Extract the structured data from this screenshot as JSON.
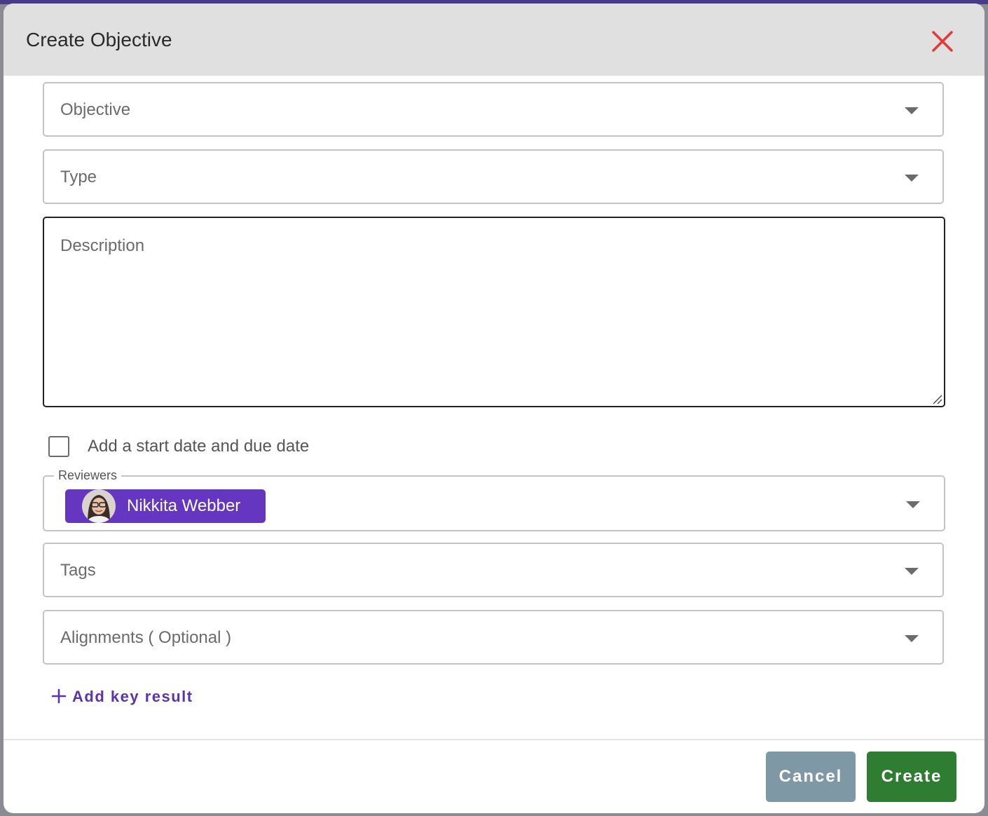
{
  "dialog": {
    "title": "Create Objective",
    "close_icon": "close-icon",
    "accent_color": "#6537c0",
    "close_color": "#e53935"
  },
  "form": {
    "objective_label": "Objective",
    "type_label": "Type",
    "description_placeholder": "Description",
    "date_checkbox_label": "Add a start date and due date",
    "date_checkbox_checked": false,
    "reviewers": {
      "label": "Reviewers",
      "selected": [
        {
          "name": "Nikkita Webber",
          "avatar": "avatar-photo"
        }
      ]
    },
    "tags_label": "Tags",
    "alignments_label": "Alignments ( Optional )",
    "add_key_result_label": "Add key result",
    "dropdown_icon": "caret-down-icon"
  },
  "footer": {
    "cancel_label": "Cancel",
    "create_label": "Create",
    "cancel_color": "#7f98a5",
    "create_color": "#2e7d32"
  }
}
